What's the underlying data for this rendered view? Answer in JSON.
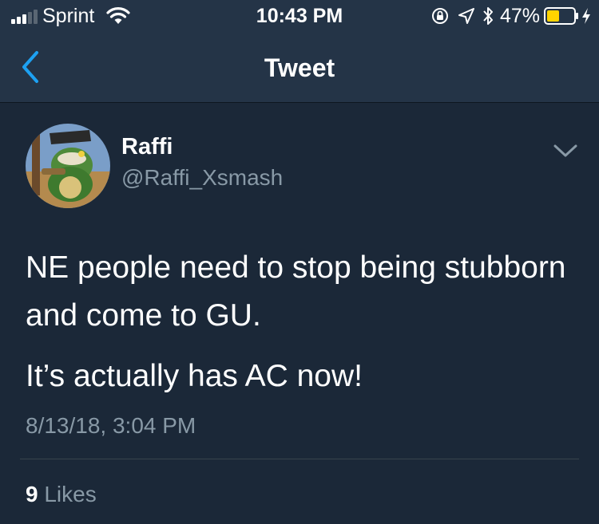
{
  "status_bar": {
    "carrier": "Sprint",
    "time": "10:43 PM",
    "battery_percent": "47%",
    "battery_level": 0.47,
    "icons": [
      "signal-icon",
      "wifi-icon",
      "orientation-lock-icon",
      "location-icon",
      "bluetooth-icon",
      "battery-icon",
      "charging-icon"
    ]
  },
  "nav": {
    "title": "Tweet",
    "back_icon": "chevron-left-icon"
  },
  "tweet": {
    "author": {
      "display_name": "Raffi",
      "handle": "@Raffi_Xsmash"
    },
    "text_line_1": "NE people need to stop being stubborn and come to GU.",
    "text_line_2": "It’s actually has AC now!",
    "timestamp": "8/13/18, 3:04 PM",
    "likes_count": "9",
    "likes_label": "Likes",
    "more_icon": "chevron-down-icon"
  },
  "colors": {
    "background": "#1b2838",
    "bar_background": "#243447",
    "accent": "#1da1f2",
    "secondary_text": "#8899a6",
    "battery": "#ffd400"
  }
}
